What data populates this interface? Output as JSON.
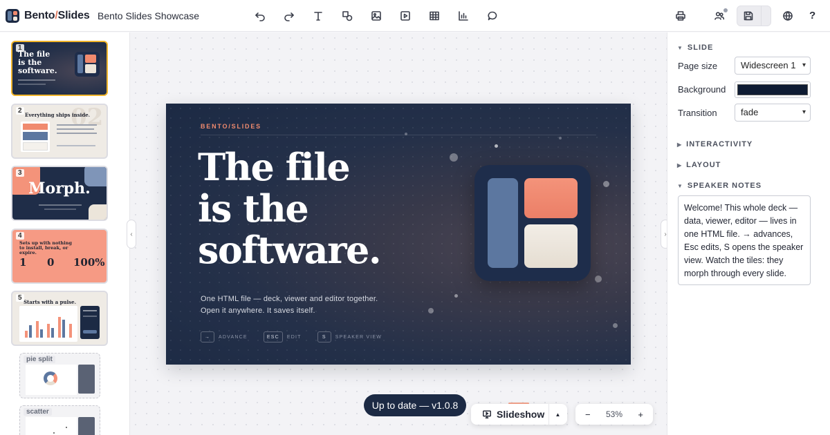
{
  "app": {
    "brand_left": "Bento",
    "brand_slash": "/",
    "brand_right": "Slides",
    "doc_title": "Bento Slides Showcase"
  },
  "toolbar": {
    "left_tools": [
      "undo-icon",
      "redo-icon",
      "text-icon",
      "shapes-icon",
      "image-icon",
      "video-icon",
      "table-icon",
      "chart-icon",
      "comment-icon"
    ],
    "right_tools": [
      "print-icon",
      "collaborators-icon",
      "save-icon",
      "globe-icon",
      "help-icon"
    ],
    "help_label": "?"
  },
  "thumbnails": [
    {
      "num": "1",
      "active": true
    },
    {
      "num": "2",
      "active": false
    },
    {
      "num": "3",
      "active": false
    },
    {
      "num": "4",
      "active": false
    },
    {
      "num": "5",
      "active": false
    }
  ],
  "ghost_thumbs": [
    {
      "label": "pie split"
    },
    {
      "label": "scatter"
    }
  ],
  "thumb_text": {
    "t1_title": "The file is the software.",
    "t2_title": "Everything ships inside.",
    "t2_big": "02",
    "t3_title": "Morph.",
    "t4_title": "Sets up with nothing to install, break, or expire.",
    "t4_stats": [
      "1",
      "0",
      "100%"
    ],
    "t5_title": "Starts with a pulse."
  },
  "slide": {
    "kicker": "BENTO/SLIDES",
    "headline": [
      "The file",
      "is the",
      "software."
    ],
    "sub": [
      "One HTML file — deck, viewer and editor together.",
      "Open it anywhere. It saves itself."
    ],
    "keys": [
      {
        "key": "→",
        "label": "ADVANCE"
      },
      {
        "key": "ESC",
        "label": "EDIT"
      },
      {
        "key": "S",
        "label": "SPEAKER VIEW"
      }
    ]
  },
  "panel": {
    "slide_section": "SLIDE",
    "page_size_label": "Page size",
    "page_size_value": "Widescreen 1",
    "background_label": "Background",
    "background_color": "#0f1c33",
    "transition_label": "Transition",
    "transition_value": "fade",
    "interactivity_section": "INTERACTIVITY",
    "layout_section": "LAYOUT",
    "notes_section": "SPEAKER NOTES",
    "notes_text": "Welcome! This whole deck — data, viewer, editor — lives in one HTML file. → advances, Esc edits, S opens the speaker view. Watch the tiles: they morph through every slide."
  },
  "status": {
    "update_text": "Up to date — v1.0.8",
    "slideshow_label": "Slideshow",
    "zoom_minus": "−",
    "zoom_value": "53%",
    "zoom_plus": "+"
  },
  "colors": {
    "accent": "#f0b429",
    "brand_navy": "#1c2a44",
    "coral": "#f08a6e"
  }
}
